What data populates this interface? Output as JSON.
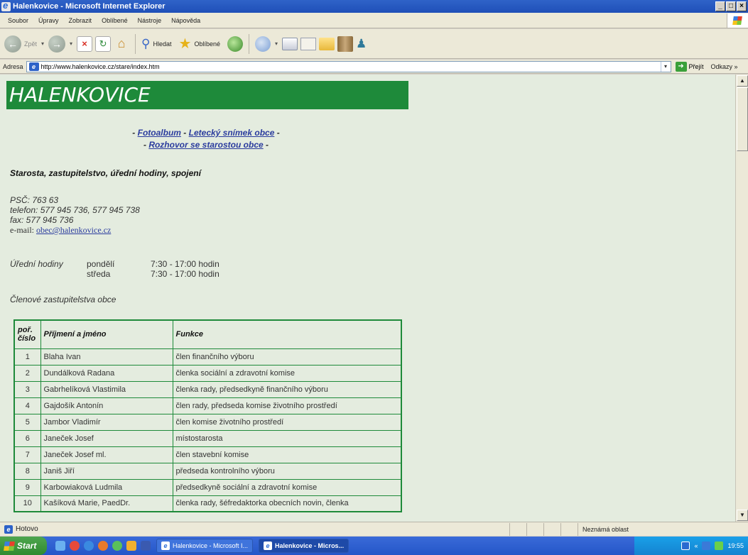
{
  "window": {
    "title": "Halenkovice - Microsoft Internet Explorer",
    "minimize": "_",
    "maximize": "□",
    "close": "×"
  },
  "menubar": {
    "items": [
      "Soubor",
      "Úpravy",
      "Zobrazit",
      "Oblíbené",
      "Nástroje",
      "Nápověda"
    ]
  },
  "toolbar": {
    "back_label": "Zpět",
    "search_label": "Hledat",
    "favorites_label": "Oblíbené"
  },
  "addressbar": {
    "label": "Adresa",
    "url": "http://www.halenkovice.cz/stare/index.htm",
    "go_label": "Přejít",
    "links_label": "Odkazy »"
  },
  "page": {
    "banner": "HALENKOVICE",
    "nav": {
      "link1": "Fotoalbum",
      "link2": "Letecký snímek obce",
      "link3": "Rozhovor se starostou obce",
      "sep": "-"
    },
    "section_title": "Starosta, zastupitelstvo, úřední hodiny, spojení",
    "contact": {
      "psc": "PSČ: 763 63",
      "telefon": "telefon: 577 945 736, 577 945 738",
      "fax": "fax: 577 945 736",
      "email_label": "e-mail:",
      "email": "obec@halenkovice.cz"
    },
    "hours": {
      "label": "Úřední hodiny",
      "rows": [
        {
          "day": "pondělí",
          "time": "7:30 - 17:00 hodin"
        },
        {
          "day": "středa",
          "time": "7:30 - 17:00 hodin"
        }
      ]
    },
    "members_title": "Členové zastupitelstva obce",
    "table": {
      "headers": [
        "poř. číslo",
        "Příjmení a jméno",
        "Funkce"
      ],
      "rows": [
        {
          "num": "1",
          "name": "Blaha Ivan",
          "func": "člen finančního výboru"
        },
        {
          "num": "2",
          "name": "Dundálková Radana",
          "func": "členka sociální a zdravotní komise"
        },
        {
          "num": "3",
          "name": "Gabrhelíková Vlastimila",
          "func": "členka rady, předsedkyně finančního výboru"
        },
        {
          "num": "4",
          "name": "Gajdošík Antonín",
          "func": "člen rady, předseda komise životního prostředí"
        },
        {
          "num": "5",
          "name": "Jambor Vladimír",
          "func": "člen komise životního prostředí"
        },
        {
          "num": "6",
          "name": "Janeček Josef",
          "func": "místostarosta"
        },
        {
          "num": "7",
          "name": "Janeček Josef ml.",
          "func": "člen stavební komise"
        },
        {
          "num": "8",
          "name": "Janiš Jiří",
          "func": "předseda kontrolního výboru"
        },
        {
          "num": "9",
          "name": "Karbowiaková Ludmila",
          "func": "předsedkyně sociální a zdravotní komise"
        },
        {
          "num": "10",
          "name": "Kašíková Marie, PaedDr.",
          "func": "členka rady, šéfredaktorka obecních novin, členka"
        }
      ]
    }
  },
  "statusbar": {
    "text": "Hotovo",
    "zone": "Neznámá oblast"
  },
  "taskbar": {
    "start": "Start",
    "tasks": [
      {
        "label": "Halenkovice - Microsoft I...",
        "active": false
      },
      {
        "label": "Halenkovice - Micros...",
        "active": true
      }
    ],
    "clock": "19:55"
  },
  "colors": {
    "banner_bg": "#1e8a3a",
    "page_bg": "#e4ecdf",
    "link": "#2b3c9e"
  }
}
